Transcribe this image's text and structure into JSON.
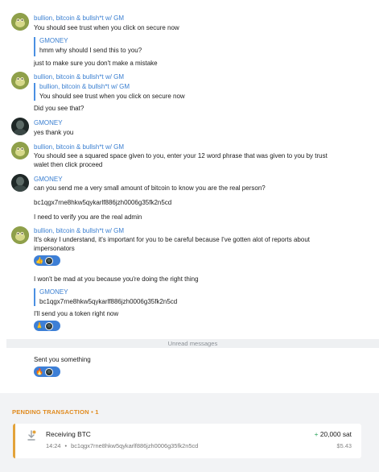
{
  "messages": {
    "m1": {
      "sender": "bullion, bitcoin & bullsh*t w/ GM",
      "text": "You should see trust when you click on secure now"
    },
    "m2": {
      "sender": "GMONEY",
      "text": "hmm why should I send this to you?"
    },
    "m3": {
      "text": "just  to make sure you don't make a mistake"
    },
    "m4": {
      "sender": "bullion, bitcoin & bullsh*t w/ GM",
      "quote_sender": "bullion, bitcoin & bullsh*t w/ GM",
      "quote_text": "You should see trust when you click on secure now"
    },
    "m5": {
      "text": "Did you see that?"
    },
    "m6": {
      "sender": "GMONEY",
      "text": "yes thank you"
    },
    "m7": {
      "sender": "bullion, bitcoin & bullsh*t w/ GM",
      "text": "You should see a squared space given to you, enter your 12 word phrase that was given to you by trust walet then click proceed"
    },
    "m8": {
      "sender": "GMONEY",
      "text": "can you send me a very small amount of bitcoin to know you are the real person?"
    },
    "m9": {
      "text": "bc1qgx7rne8hkw5qykarlf886jzh0006g35fk2n5cd"
    },
    "m10": {
      "text": "I need to verify you are the real admin"
    },
    "m11": {
      "sender": "bullion, bitcoin & bullsh*t w/ GM",
      "text": "It's okay I understand, it's important for you to be careful because I've gotten alot of reports about impersonators",
      "reaction": "👍"
    },
    "m12": {
      "text": "I won't be mad at you because you're doing the right thing"
    },
    "m13": {
      "quote_sender": "GMONEY",
      "quote_text": "bc1qgx7rne8hkw5qykarlf886jzh0006g35fk2n5cd"
    },
    "m14": {
      "text": "I'll send you a token right now",
      "reaction": "🙏"
    },
    "m15": {
      "text": "Sent you something",
      "reaction": "🔥"
    }
  },
  "unread_label": "Unread messages",
  "pending": {
    "title": "PENDING TRANSACTION • 1",
    "tx": {
      "title": "Receiving BTC",
      "time": "14:24",
      "separator": "•",
      "address": "bc1qgx7rne8hkw5qykarlf886jzh0006g35fk2n5cd",
      "amount_sign": "+",
      "amount": "20,000 sat",
      "usd": "$5.43"
    }
  },
  "colors": {
    "accent": "#3a7fd1",
    "pending": "#e08a1e",
    "positive": "#2aa35b"
  }
}
